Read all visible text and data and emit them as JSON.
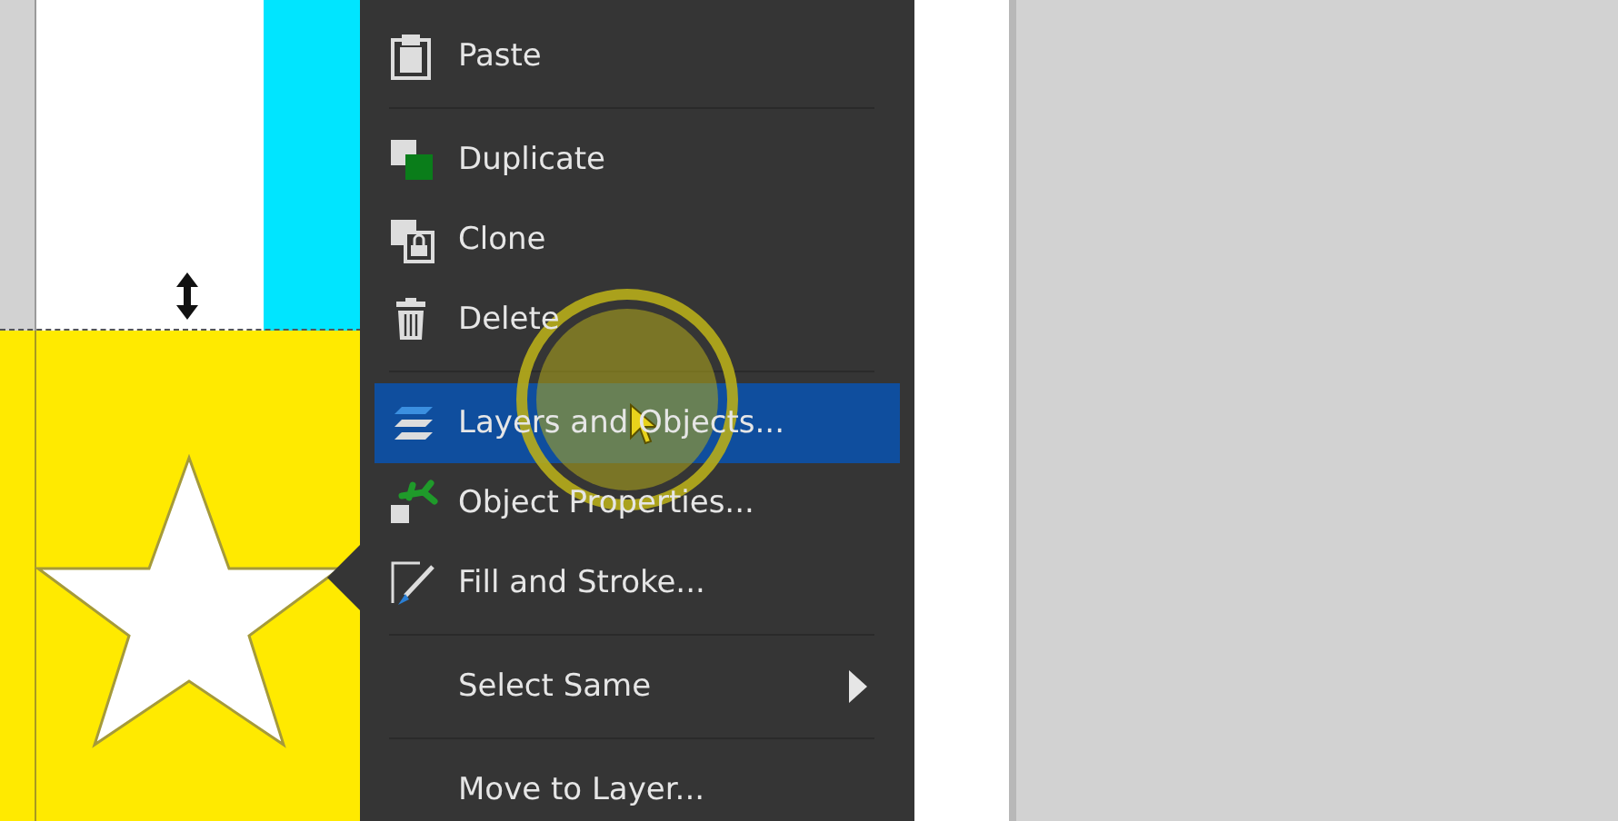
{
  "context_menu": {
    "items": [
      {
        "kind": "item",
        "label": "Paste",
        "selected": false
      },
      {
        "kind": "separator"
      },
      {
        "kind": "item",
        "label": "Duplicate",
        "selected": false
      },
      {
        "kind": "item",
        "label": "Clone",
        "selected": false
      },
      {
        "kind": "item",
        "label": "Delete",
        "selected": false
      },
      {
        "kind": "separator"
      },
      {
        "kind": "item",
        "label": "Layers and Objects...",
        "selected": true
      },
      {
        "kind": "item",
        "label": "Object Properties...",
        "selected": false
      },
      {
        "kind": "item",
        "label": "Fill and Stroke...",
        "selected": false
      },
      {
        "kind": "separator"
      },
      {
        "kind": "submenu",
        "label": "Select Same",
        "selected": false
      },
      {
        "kind": "separator"
      },
      {
        "kind": "item",
        "label": "Move to Layer...",
        "selected": false
      }
    ]
  }
}
